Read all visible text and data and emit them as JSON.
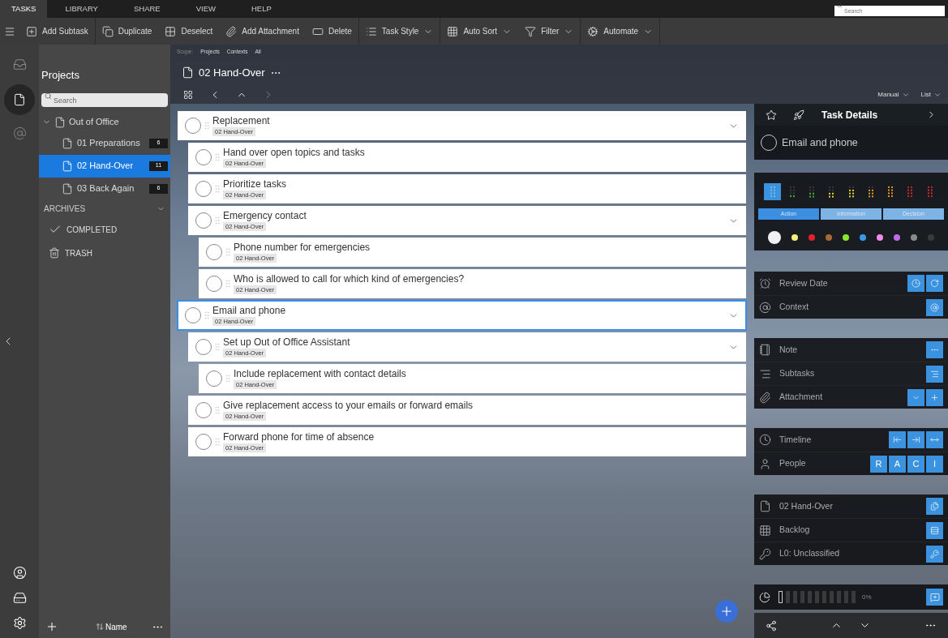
{
  "menu_tabs": [
    {
      "label": "TASKS",
      "selected": true
    },
    {
      "label": "LIBRARY",
      "selected": false
    },
    {
      "label": "SHARE",
      "selected": false
    },
    {
      "label": "VIEW",
      "selected": false
    },
    {
      "label": "HELP",
      "selected": false
    }
  ],
  "global_search": {
    "placeholder": "Search"
  },
  "toolbar": [
    {
      "kind": "add_subtask",
      "label": "Add Subtask",
      "dropdown": false
    },
    {
      "kind": "duplicate",
      "label": "Duplicate",
      "dropdown": false
    },
    {
      "kind": "deselect",
      "label": "Deselect",
      "dropdown": false
    },
    {
      "kind": "attachment",
      "label": "Add Attachment",
      "dropdown": false
    },
    {
      "kind": "delete",
      "label": "Delete",
      "dropdown": false
    },
    {
      "kind": "task_style",
      "label": "Task Style",
      "dropdown": true
    },
    {
      "kind": "auto_sort",
      "label": "Auto Sort",
      "dropdown": true
    },
    {
      "kind": "filter",
      "label": "Filter",
      "dropdown": true
    },
    {
      "kind": "automate",
      "label": "Automate",
      "dropdown": true
    }
  ],
  "sidebar": {
    "title": "Projects",
    "search": {
      "placeholder": "Search"
    },
    "tree": [
      {
        "label": "Out of Office",
        "expanded": true,
        "children": [
          {
            "label": "01 Preparations",
            "count": "6",
            "selected": false
          },
          {
            "label": "02 Hand-Over",
            "count": "11",
            "selected": true
          },
          {
            "label": "03 Back Again",
            "count": "6",
            "selected": false
          }
        ]
      }
    ],
    "archives": {
      "label": "ARCHIVES",
      "expanded": true,
      "items": [
        {
          "kind": "completed",
          "label": "COMPLETED"
        },
        {
          "kind": "trash",
          "label": "TRASH"
        }
      ]
    },
    "sort_label": "Name"
  },
  "main": {
    "scope": {
      "label": "Scope:",
      "options": [
        "Projects",
        "Contexts",
        "All"
      ]
    },
    "title": "02 Hand-Over",
    "sort": "Manual",
    "view": "List",
    "tasks": [
      {
        "title": "Replacement",
        "tag": "02 Hand-Over",
        "selected": false,
        "expanded": true,
        "children": [
          {
            "title": "Hand over open topics and tasks",
            "tag": "02 Hand-Over",
            "selected": false
          },
          {
            "title": "Prioritize tasks",
            "tag": "02 Hand-Over",
            "selected": false
          },
          {
            "title": "Emergency contact",
            "tag": "02 Hand-Over",
            "selected": false,
            "expanded": true,
            "children": [
              {
                "title": "Phone number for emergencies",
                "tag": "02 Hand-Over",
                "selected": false
              },
              {
                "title": "Who is allowed to call for which kind of emergencies?",
                "tag": "02 Hand-Over",
                "selected": false
              }
            ]
          }
        ]
      },
      {
        "title": "Email and phone",
        "tag": "02 Hand-Over",
        "selected": true,
        "expanded": true,
        "children": [
          {
            "title": "Set up Out of Office Assistant",
            "tag": "02 Hand-Over",
            "selected": false,
            "expanded": true,
            "children": [
              {
                "title": "Include replacement with contact details",
                "tag": "02 Hand-Over",
                "selected": false
              }
            ]
          },
          {
            "title": "Give replacement access to your emails or forward emails",
            "tag": "02 Hand-Over",
            "selected": false
          },
          {
            "title": "Forward phone for time of absence",
            "tag": "02 Hand-Over",
            "selected": false
          }
        ]
      }
    ]
  },
  "details": {
    "title": "Task Details",
    "task": "Email and phone",
    "checked": false,
    "priorities": [
      {
        "selected": true
      },
      {
        "color": "#3fae2a",
        "level": 0.25,
        "selected": false
      },
      {
        "color": "#3fae2a",
        "level": 0.5,
        "selected": false
      },
      {
        "color": "#e8d42a",
        "level": 0.5,
        "selected": false
      },
      {
        "color": "#e8d42a",
        "level": 0.75,
        "selected": false
      },
      {
        "color": "#e89a1a",
        "level": 0.75,
        "selected": false
      },
      {
        "color": "#e89a1a",
        "level": 1,
        "selected": false
      },
      {
        "color": "#c42a2a",
        "level": 1,
        "selected": false
      },
      {
        "color": "#c42a2a",
        "level": 1,
        "selected": false
      }
    ],
    "types": [
      {
        "label": "Action",
        "selected": true
      },
      {
        "label": "Information",
        "selected": false
      },
      {
        "label": "Decision",
        "selected": false
      }
    ],
    "colors": [
      {
        "color": "#f0f0f5",
        "selected": true
      },
      {
        "color": "#f4f07a",
        "selected": false
      },
      {
        "color": "#e8202a",
        "selected": false
      },
      {
        "color": "#a86a30",
        "selected": false
      },
      {
        "color": "#8ae82a",
        "selected": false
      },
      {
        "color": "#3a9ae8",
        "selected": false
      },
      {
        "color": "#f08ae8",
        "selected": false
      },
      {
        "color": "#c06ae8",
        "selected": false
      },
      {
        "color": "#8a8a8a",
        "selected": false
      },
      {
        "color": "#3a3a3a",
        "selected": false
      }
    ],
    "groups": [
      [
        {
          "kind": "review_date",
          "label": "Review Date"
        },
        {
          "kind": "context",
          "label": "Context"
        }
      ],
      [
        {
          "kind": "note",
          "label": "Note"
        },
        {
          "kind": "subtasks",
          "label": "Subtasks"
        },
        {
          "kind": "attachment",
          "label": "Attachment"
        }
      ],
      [
        {
          "kind": "timeline",
          "label": "Timeline"
        },
        {
          "kind": "people",
          "label": "People",
          "buttons": [
            "R",
            "A",
            "C",
            "I"
          ]
        }
      ],
      [
        {
          "kind": "project",
          "label": "02 Hand-Over"
        },
        {
          "kind": "backlog",
          "label": "Backlog"
        },
        {
          "kind": "classification",
          "label": "L0: Unclassified"
        }
      ]
    ],
    "progress": {
      "level": 0,
      "reading": "0%"
    }
  }
}
